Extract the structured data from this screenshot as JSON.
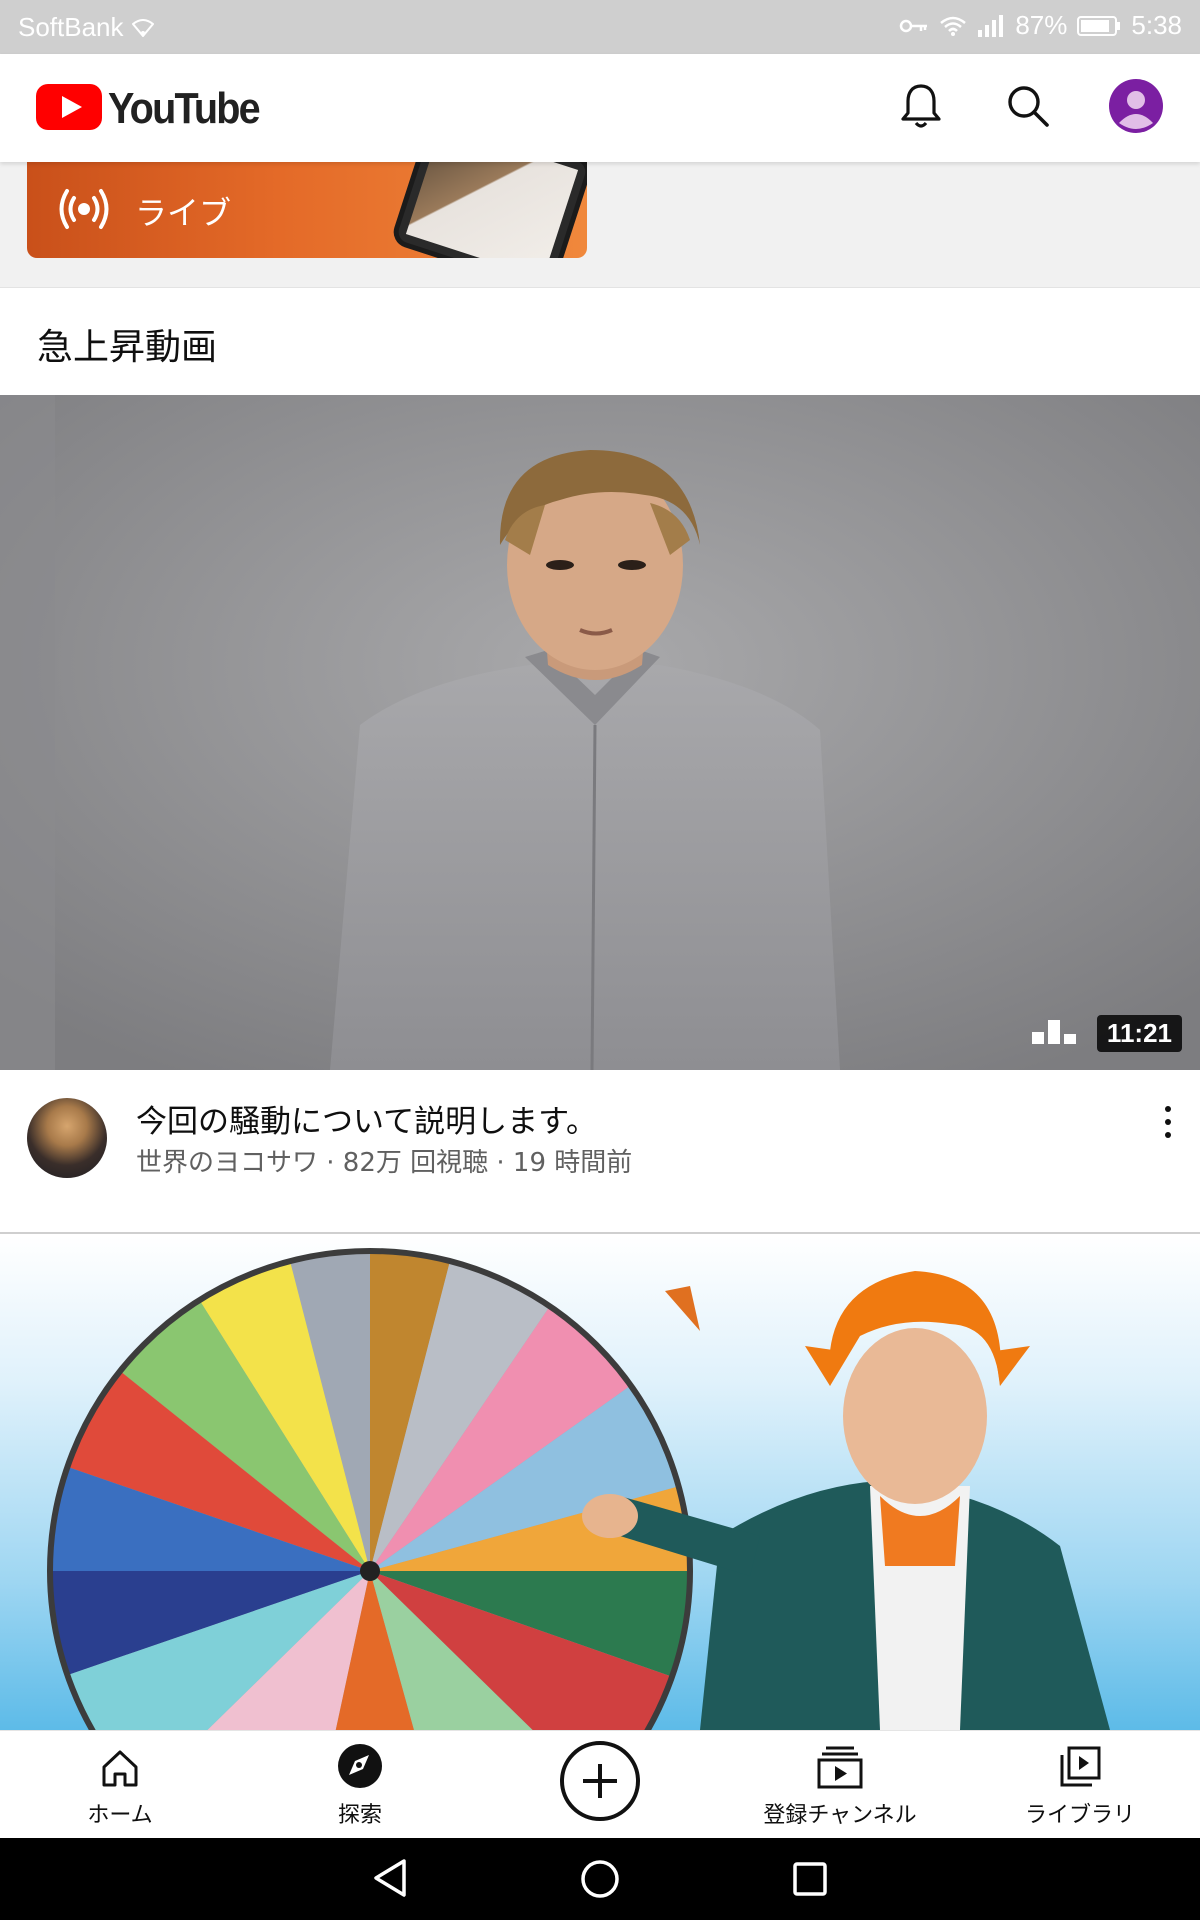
{
  "status_bar": {
    "carrier": "SoftBank",
    "battery": "87%",
    "time": "5:38"
  },
  "app_bar": {
    "logo_text": "YouTube",
    "icons": [
      "bell-icon",
      "search-icon",
      "account-avatar"
    ]
  },
  "live_chip": {
    "label": "ライブ"
  },
  "section": {
    "title": "急上昇動画"
  },
  "videos": [
    {
      "title": "今回の騒動について説明します。",
      "channel_line": "世界のヨコサワ · 82万 回視聴 · 19 時間前",
      "duration": "11:21"
    }
  ],
  "bottom_nav": {
    "items": [
      {
        "label": "ホーム",
        "icon": "home-icon"
      },
      {
        "label": "探索",
        "icon": "explore-icon"
      },
      {
        "label": "",
        "icon": "create-icon"
      },
      {
        "label": "登録チャンネル",
        "icon": "subscriptions-icon"
      },
      {
        "label": "ライブラリ",
        "icon": "library-icon"
      }
    ]
  },
  "colors": {
    "youtube_red": "#ff0000",
    "live_orange": "#e46a28",
    "avatar_purple": "#7b1fa2"
  }
}
